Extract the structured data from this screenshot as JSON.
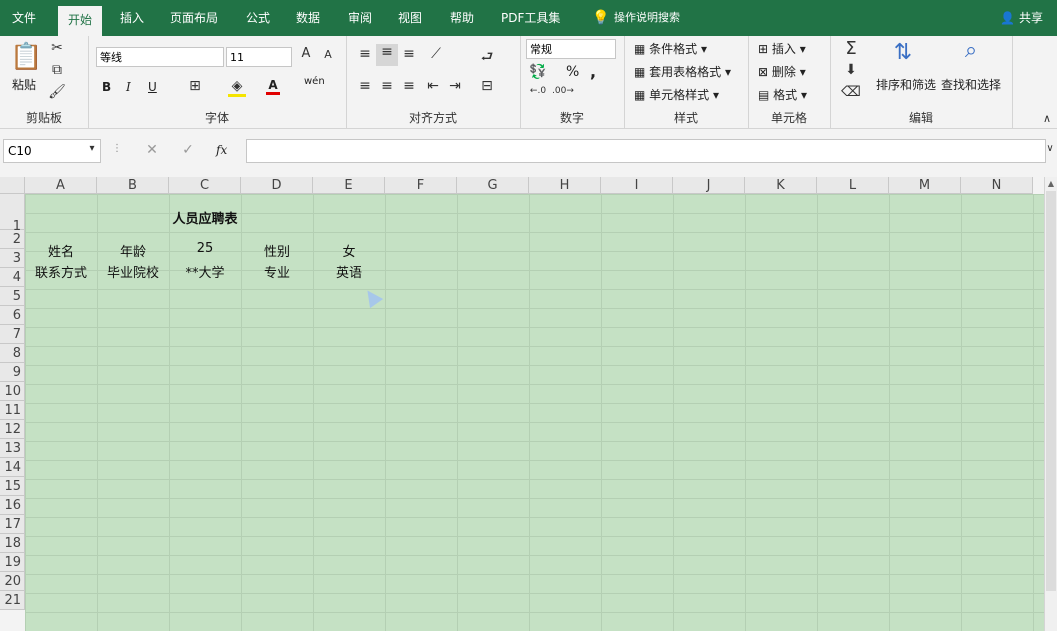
{
  "tabs": [
    "文件",
    "开始",
    "插入",
    "页面布局",
    "公式",
    "数据",
    "审阅",
    "视图",
    "帮助",
    "PDF工具集"
  ],
  "tell_me": "操作说明搜索",
  "share": "共享",
  "ribbon": {
    "clipboard": {
      "paste": "粘贴",
      "label": "剪贴板"
    },
    "font": {
      "name": "等线",
      "size": "11",
      "bold": "B",
      "italic": "I",
      "underline": "U",
      "font_color_letter": "A",
      "phonetic": "wén",
      "label": "字体"
    },
    "align": {
      "label": "对齐方式"
    },
    "number": {
      "format": "常规",
      "percent": "%",
      "comma": ",",
      "label": "数字"
    },
    "styles": {
      "cond": "条件格式",
      "table": "套用表格格式",
      "cell": "单元格样式",
      "label": "样式"
    },
    "cells": {
      "insert": "插入",
      "delete": "删除",
      "format": "格式",
      "label": "单元格"
    },
    "editing": {
      "sort": "排序和筛选",
      "find": "查找和选择",
      "label": "编辑"
    }
  },
  "formula_bar": {
    "name_box": "C10",
    "fx": "fx",
    "value": ""
  },
  "grid": {
    "columns": [
      "A",
      "B",
      "C",
      "D",
      "E",
      "F",
      "G",
      "H",
      "I",
      "J",
      "K",
      "L",
      "M",
      "N"
    ],
    "rows": [
      "1",
      "2",
      "3",
      "4",
      "5",
      "6",
      "7",
      "8",
      "9",
      "10",
      "11",
      "12",
      "13",
      "14",
      "15",
      "16",
      "17",
      "18",
      "19",
      "20",
      "21"
    ],
    "cells": {
      "title": "人员应聘表",
      "a2": "姓名",
      "b2": "年龄",
      "c2": "25",
      "d2": "性别",
      "e2": "女",
      "a3": "联系方式",
      "b3": "毕业院校",
      "c3": "**大学",
      "d3": "专业",
      "e3": "英语"
    },
    "fill_color": "#c5e1c4"
  },
  "accent": "#217346"
}
